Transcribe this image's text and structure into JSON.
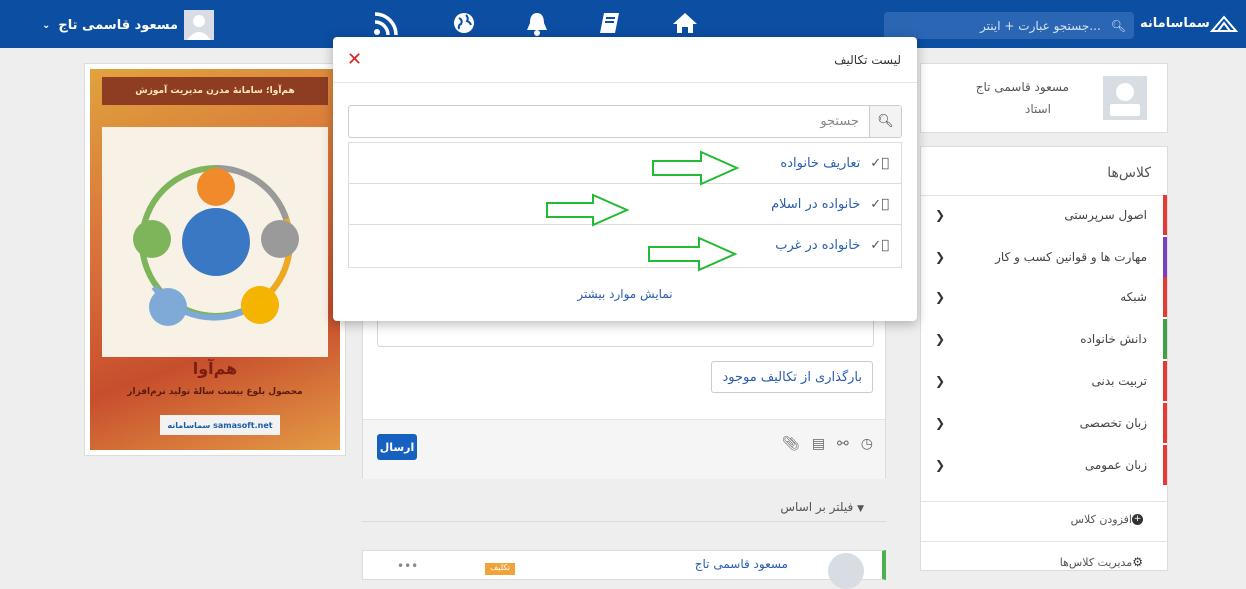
{
  "topbar": {
    "user_name": "مسعود قاسمی تاج",
    "search_placeholder": "جستجو عبارت + اینتر...",
    "logo_text": "سماسامانه",
    "icons": [
      "rss-icon",
      "globe-icon",
      "bell-icon",
      "book-icon",
      "home-icon"
    ]
  },
  "profile": {
    "name": "مسعود قاسمی تاج",
    "role": "استاد"
  },
  "classes": {
    "title": "کلاس‌ها",
    "items": [
      {
        "label": "اصول سرپرستی",
        "color": "#e53935"
      },
      {
        "label": "مهارت ها و قوانین کسب و کار",
        "color": "#7b3fbf"
      },
      {
        "label": "شبکه",
        "color": "#e53935"
      },
      {
        "label": "دانش خانواده",
        "color": "#43a047"
      },
      {
        "label": "تربیت بدنی",
        "color": "#e53935"
      },
      {
        "label": "زبان تخصصی",
        "color": "#e53935"
      },
      {
        "label": "زبان عمومی",
        "color": "#e53935"
      }
    ],
    "add_label": "افزودن کلاس",
    "manage_label": "مدیریت کلاس‌ها"
  },
  "poster": {
    "banner": "هم‌آوا؛ سامانهٔ مدرن مدیریت آموزش",
    "title": "هم‌آوا",
    "subtitle": "محصول بلوغ بیست سالهٔ تولید نرم‌افزار",
    "logo": "سماسامانه samasoft.net"
  },
  "feed": {
    "upload_label": "بارگذاری از تکالیف موجود",
    "send_label": "ارسال",
    "filter_label": "فیلتر بر اساس"
  },
  "post": {
    "author": "مسعود قاسمی تاج",
    "badge": "تکلیف"
  },
  "modal": {
    "title": "لیست تکالیف",
    "search_placeholder": "جستجو",
    "items": [
      "تعاریف خانواده",
      "خانواده در اسلام",
      "خانواده در غرب"
    ],
    "show_more": "نمایش موارد بیشتر"
  }
}
